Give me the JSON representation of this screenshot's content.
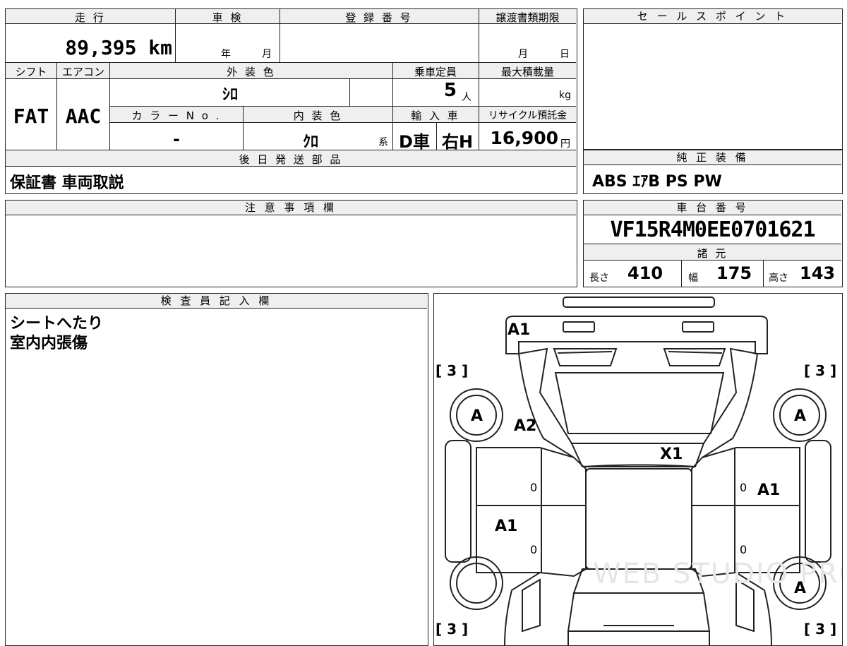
{
  "top_table": {
    "mileage_label": "走 行",
    "mileage_value": "89,395 km",
    "inspection_label": "車 検",
    "inspection_year_unit": "年",
    "inspection_month_unit": "月",
    "registration_label": "登 録 番 号",
    "transfer_deadline_label": "譲渡書類期限",
    "transfer_month_unit": "月",
    "transfer_day_unit": "日",
    "shift_label": "シフト",
    "shift_value": "FAT",
    "aircon_label": "エアコン",
    "aircon_value": "AAC",
    "exterior_label": "外 装 色",
    "exterior_value": "ｼﾛ",
    "capacity_label": "乗車定員",
    "capacity_value": "5",
    "capacity_unit": "人",
    "max_load_label": "最大積載量",
    "max_load_unit": "kg",
    "color_no_label": "カ ラ ー N o .",
    "color_no_value": "-",
    "interior_label": "内 装 色",
    "interior_value": "ｸﾛ",
    "interior_suffix": "系",
    "import_label": "輸 入 車",
    "import_d": "D車",
    "import_h": "右H",
    "recycle_label": "リサイクル預託金",
    "recycle_value": "16,900",
    "recycle_unit": "円",
    "later_parts_label": "後 日 発 送 部 品",
    "later_parts_value": "保証書 車両取説"
  },
  "sales_point": {
    "label": "セ ー ル ス ポ イ ン ト",
    "value": ""
  },
  "standard_equipment": {
    "label": "純 正 装 備",
    "value": "ABS ｴｱB PS PW"
  },
  "notes": {
    "label": "注 意 事 項 欄",
    "value": ""
  },
  "chassis": {
    "label": "車 台 番 号",
    "value": "VF15R4M0EE0701621"
  },
  "specs": {
    "label": "諸 元",
    "length_label": "長さ",
    "length_value": "410",
    "width_label": "幅",
    "width_value": "175",
    "height_label": "高さ",
    "height_value": "143"
  },
  "inspector": {
    "label": "検 査 員 記 入 欄",
    "line1": "シートへたり",
    "line2": "室内内張傷"
  },
  "diagram": {
    "marks": {
      "front_top": "A1",
      "hood_left": "A2",
      "windshield": "X1",
      "left_front_door": "A1",
      "right_front_door": "A1",
      "wheel_fl": "A",
      "wheel_fr": "A",
      "wheel_rr": "A",
      "tire_fl": "[ 3 ]",
      "tire_fr": "[ 3 ]",
      "tire_rl": "[ 3 ]",
      "tire_rr": "[ 3 ]",
      "zero": "0"
    },
    "watermark": "WEB STUDIO PRO"
  }
}
